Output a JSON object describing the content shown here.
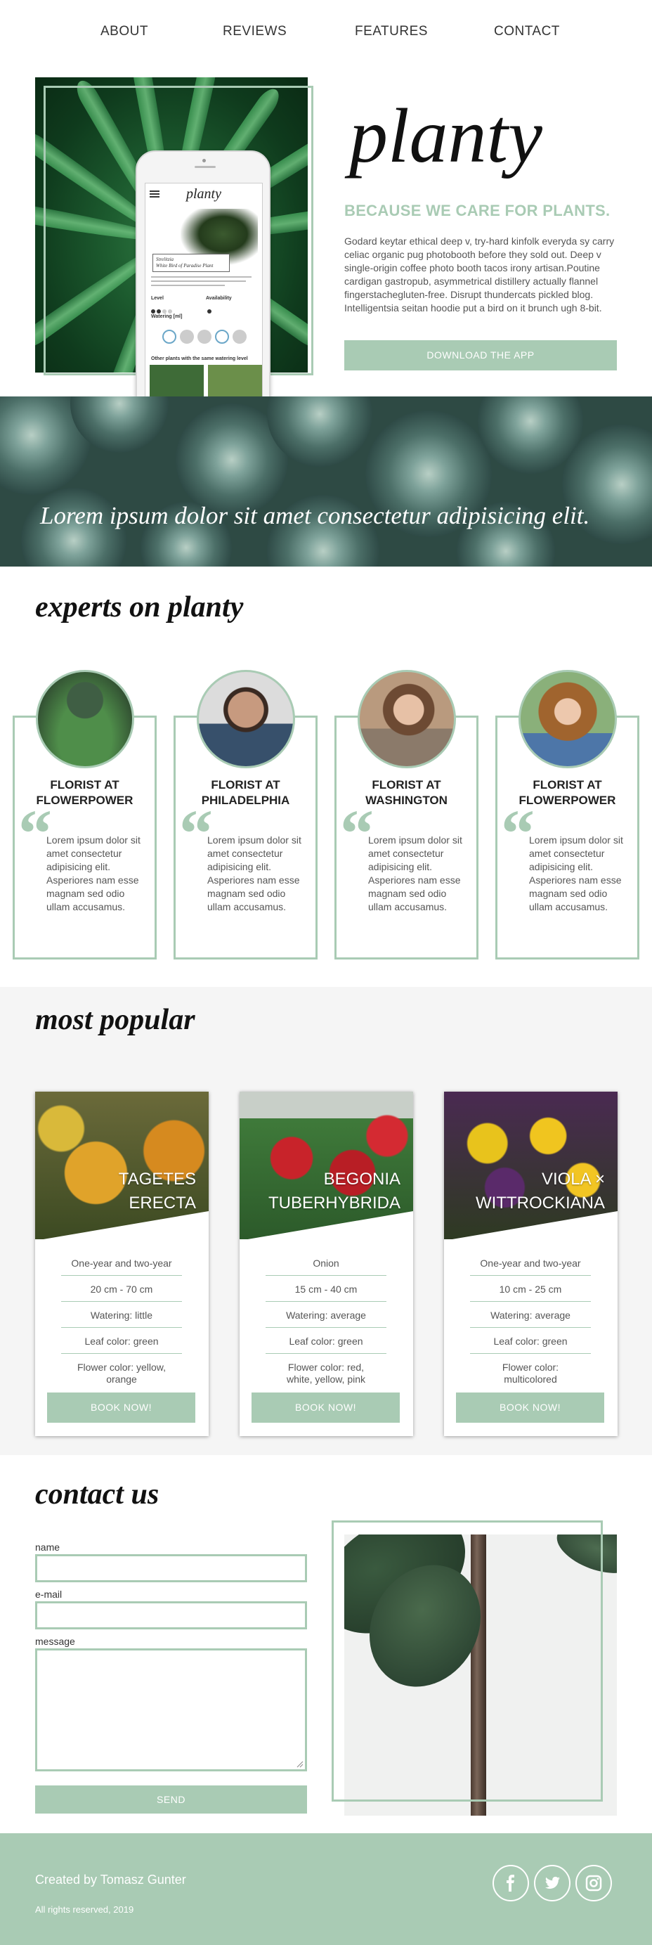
{
  "nav": {
    "items": [
      {
        "label": "ABOUT"
      },
      {
        "label": "REVIEWS"
      },
      {
        "label": "FEATURES"
      },
      {
        "label": "CONTACT"
      }
    ]
  },
  "hero": {
    "logo": "planty",
    "subtitle": "BECAUSE WE CARE FOR PLANTS.",
    "text": "Godard keytar ethical deep v, try-hard kinfolk everyda sy carry celiac organic pug photobooth before they sold out. Deep v single-origin coffee photo booth tacos irony artisan.Poutine cardigan gastropub, asymmetrical distillery actually flannel fingerstachegluten-free. Disrupt thundercats pickled blog. Intelligentsia seitan hoodie put a bird on it brunch ugh 8-bit.",
    "download_label": "DOWNLOAD THE APP",
    "phone": {
      "logo": "planty",
      "tag_line1": "Strelitzia",
      "tag_line2": "White Bird of Paradise Plant",
      "level_label": "Level",
      "availability_label": "Availability",
      "watering_label": "Watering [ml]",
      "other_plants": "Other plants with the same watering level"
    }
  },
  "banner": {
    "text": "Lorem ipsum dolor sit amet consectetur adipisicing elit."
  },
  "experts": {
    "title": "experts on planty",
    "items": [
      {
        "name": "FLORIST AT FLOWERPOWER",
        "text": "Lorem ipsum dolor sit amet consectetur adipisicing elit. Asperiores nam esse magnam sed odio ullam accusamus."
      },
      {
        "name": "FLORIST AT PHILADELPHIA",
        "text": "Lorem ipsum dolor sit amet consectetur adipisicing elit. Asperiores nam esse magnam sed odio ullam accusamus."
      },
      {
        "name": "FLORIST AT WASHINGTON",
        "text": "Lorem ipsum dolor sit amet consectetur adipisicing elit. Asperiores nam esse magnam sed odio ullam accusamus."
      },
      {
        "name": "FLORIST AT FLOWERPOWER",
        "text": "Lorem ipsum dolor sit amet consectetur adipisicing elit. Asperiores nam esse magnam sed odio ullam accusamus."
      }
    ]
  },
  "popular": {
    "title": "most popular",
    "book_label": "BOOK NOW!",
    "items": [
      {
        "name_line1": "TAGETES",
        "name_line2": "ERECTA",
        "type": "One-year and two-year",
        "height": "20 cm - 70 cm",
        "watering": "Watering: little",
        "leaf": "Leaf color: green",
        "flower_line1": "Flower color: yellow,",
        "flower_line2": "orange"
      },
      {
        "name_line1": "BEGONIA",
        "name_line2": "TUBERHYBRIDA",
        "type": "Onion",
        "height": "15 cm - 40 cm",
        "watering": "Watering: average",
        "leaf": "Leaf color: green",
        "flower_line1": "Flower color: red,",
        "flower_line2": "white, yellow, pink"
      },
      {
        "name_line1": "VIOLA ×",
        "name_line2": "WITTROCKIANA",
        "type": "One-year and two-year",
        "height": "10 cm - 25 cm",
        "watering": "Watering: average",
        "leaf": "Leaf color: green",
        "flower_line1": "Flower color:",
        "flower_line2": "multicolored"
      }
    ]
  },
  "contact": {
    "title": "contact us",
    "name_label": "name",
    "email_label": "e-mail",
    "message_label": "message",
    "send_label": "SEND"
  },
  "footer": {
    "credit": "Created by Tomasz Gunter",
    "rights": "All rights reserved, 2019"
  },
  "colors": {
    "accent": "#a9cbb4",
    "popular_bg": "#f5f5f5",
    "heading": "#111111"
  },
  "icons": [
    "menu-icon",
    "facebook-icon",
    "twitter-icon",
    "instagram-icon",
    "quote-icon"
  ]
}
